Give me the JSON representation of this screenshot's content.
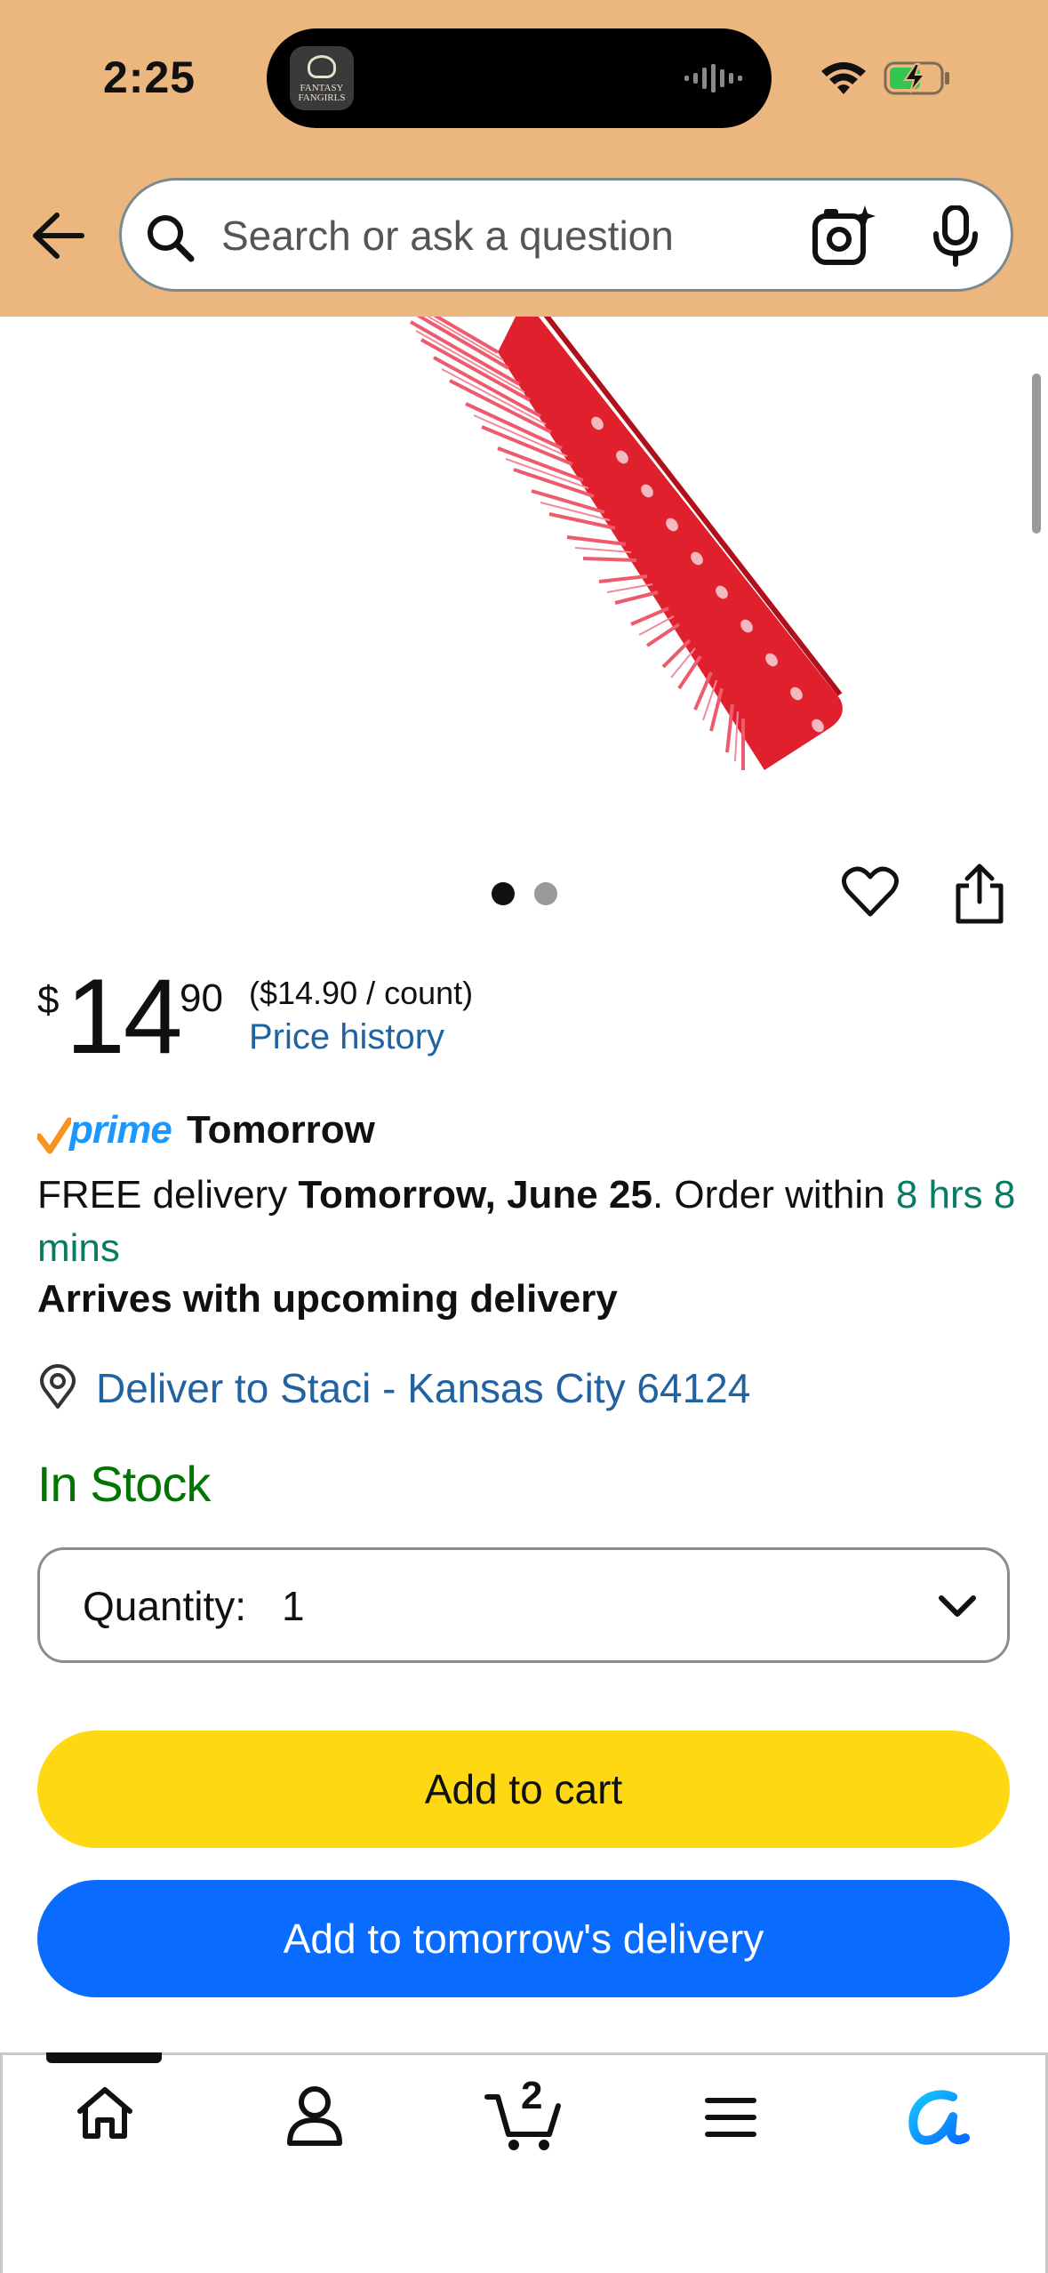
{
  "status_bar": {
    "time": "2:25",
    "island_app_label": "FANTASY FANGIRLS",
    "icons": [
      "wifi-icon",
      "battery-charging-icon",
      "audio-wave-icon"
    ]
  },
  "header": {
    "background_color": "#ecb77e",
    "search": {
      "placeholder": "Search or ask a question",
      "value": ""
    },
    "icons": [
      "back-arrow-icon",
      "search-icon",
      "camera-lens-icon",
      "microphone-icon"
    ]
  },
  "product": {
    "image_description_icon": "red-comb-image",
    "carousel": {
      "count": 2,
      "active_index": 0
    },
    "actions": [
      "heart-icon",
      "share-icon"
    ]
  },
  "price": {
    "symbol": "$",
    "whole": "14",
    "fraction": "90",
    "unit_price": "($14.90 / count)",
    "history_link": "Price history"
  },
  "delivery": {
    "prime_label": "prime",
    "prime_when": "Tomorrow",
    "free_prefix": "FREE delivery ",
    "free_date": "Tomorrow, June 25",
    "order_within_prefix": ". Order within ",
    "order_within_time": "8 hrs 8 mins",
    "arrives_text": "Arrives with upcoming delivery",
    "deliver_to": "Deliver to Staci - Kansas City 64124",
    "green_color": "#067d62",
    "link_color": "#2162a1"
  },
  "stock": {
    "text": "In Stock",
    "color": "#007600"
  },
  "quantity": {
    "label": "Quantity:",
    "value": "1"
  },
  "buttons": {
    "add_to_cart": "Add to cart",
    "add_to_cart_color": "#ffd814",
    "add_tomorrow": "Add to tomorrow's delivery",
    "add_tomorrow_color": "#0a6cff"
  },
  "bottom_nav": {
    "items": [
      "home-icon",
      "profile-icon",
      "cart-icon",
      "menu-icon",
      "rufus-icon"
    ],
    "cart_count": "2",
    "active_item": "home-icon"
  }
}
